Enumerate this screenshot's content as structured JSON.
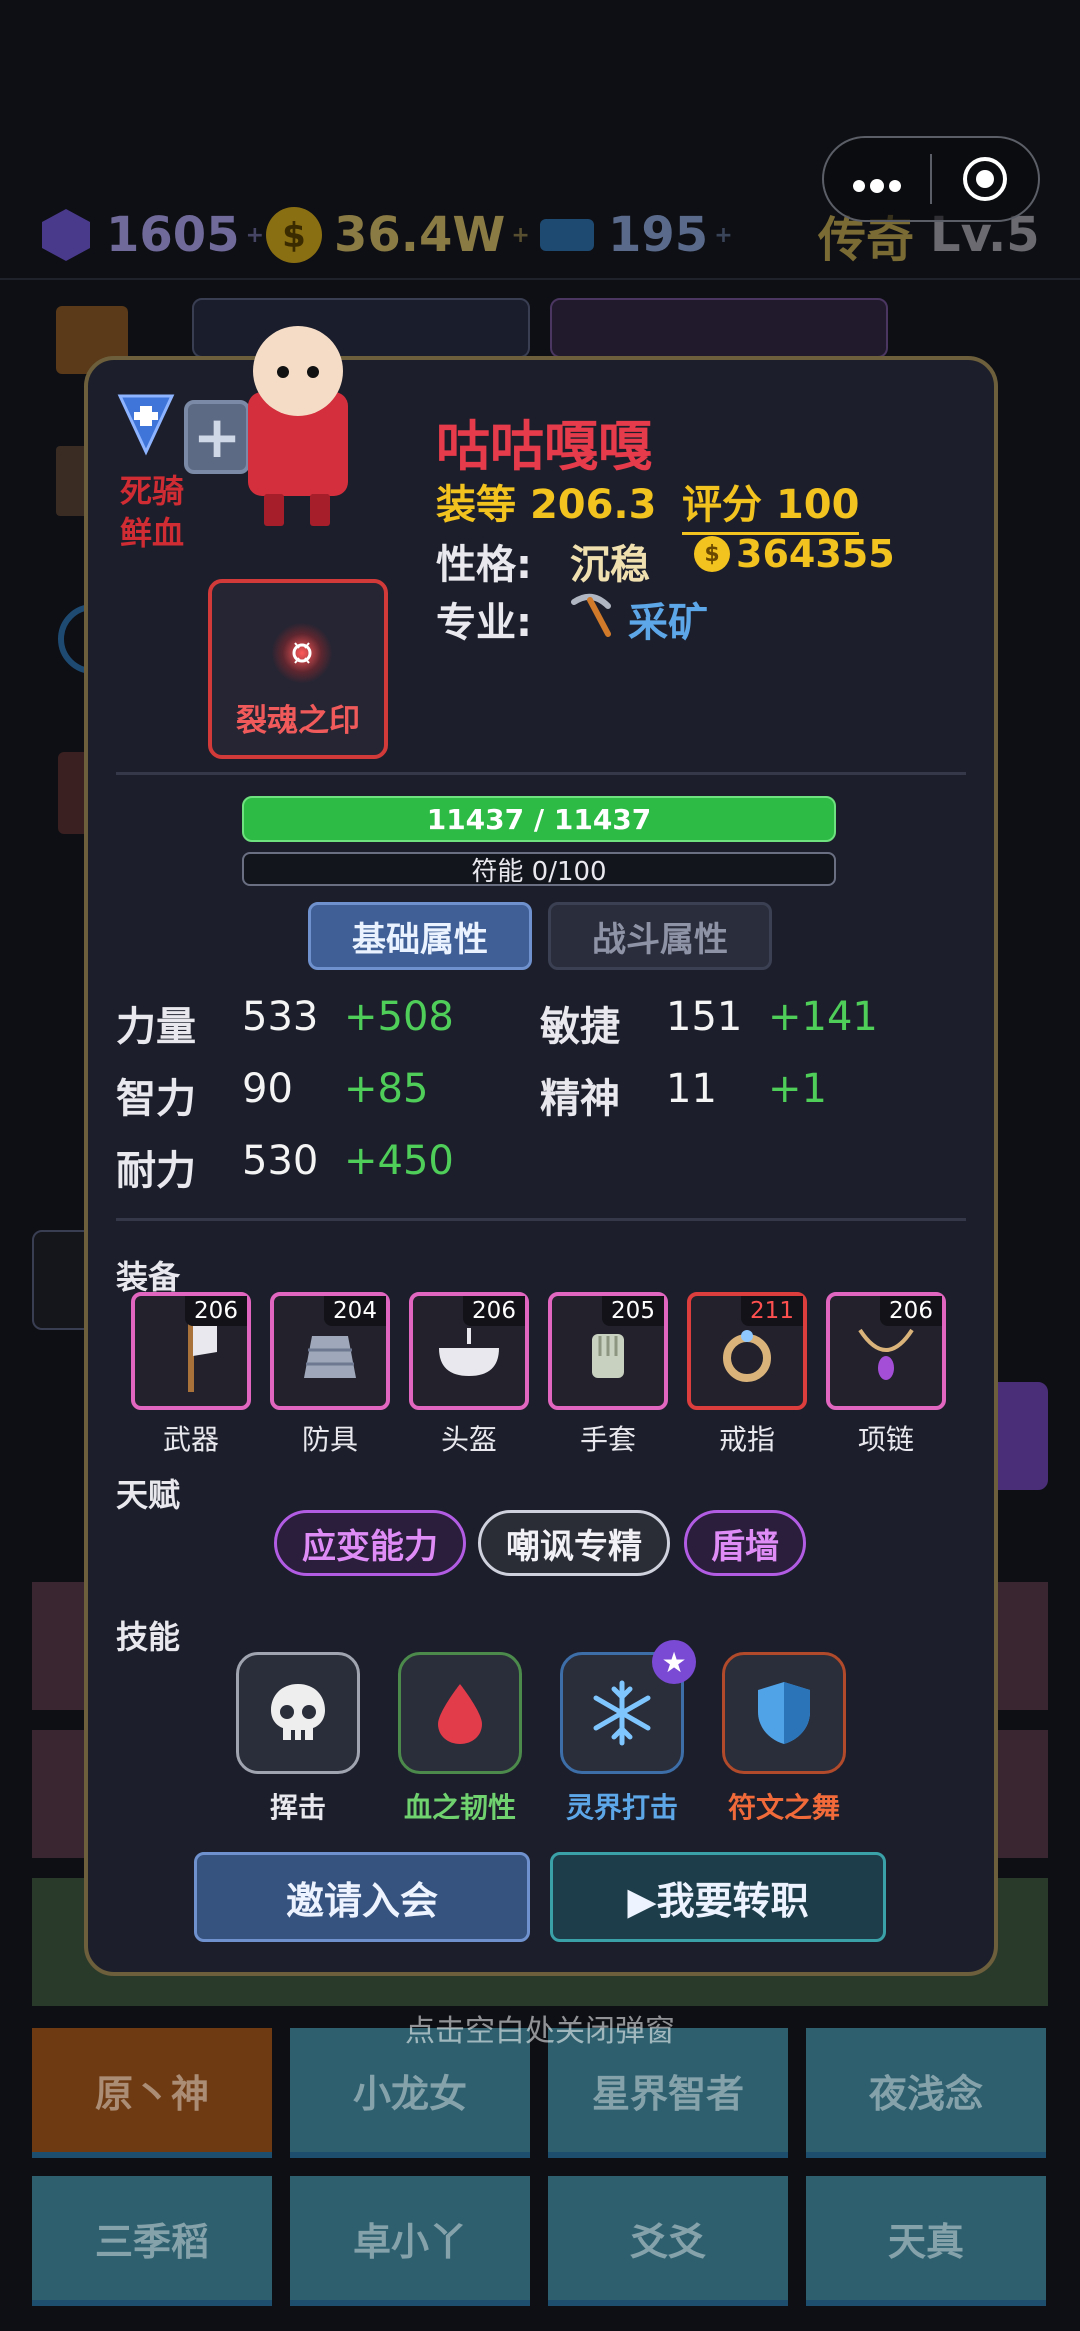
{
  "top_bar": {
    "gems": "1605",
    "coins": "36.4W",
    "tickets": "195",
    "rank": "传奇",
    "level": "Lv.5",
    "plus": "+"
  },
  "background": {
    "grid_names": [
      "原丶神",
      "小龙女",
      "星界智者",
      "夜浅念",
      "三季稻",
      "卓小丫",
      "爻爻",
      "天真"
    ]
  },
  "profile": {
    "tag_text": "死骑\n鲜血",
    "seal_label": "裂魂之印",
    "name": "咕咕嘎嘎",
    "gear_score_label": "装等",
    "gear_score": "206.3",
    "rating_label": "评分",
    "rating": "100",
    "personality_label": "性格:",
    "personality": "沉稳",
    "gold": "364355",
    "profession_label": "专业:",
    "profession": "采矿"
  },
  "bars": {
    "hp_text": "11437 / 11437",
    "rune_text": "符能 0/100"
  },
  "tabs": {
    "basic": "基础属性",
    "combat": "战斗属性"
  },
  "stats": [
    {
      "name": "力量",
      "base": "533",
      "bonus": "+508"
    },
    {
      "name": "敏捷",
      "base": "151",
      "bonus": "+141"
    },
    {
      "name": "智力",
      "base": "90",
      "bonus": "+85"
    },
    {
      "name": "精神",
      "base": "11",
      "bonus": "+1"
    },
    {
      "name": "耐力",
      "base": "530",
      "bonus": "+450"
    }
  ],
  "equipment": {
    "title": "装备",
    "items": [
      {
        "label": "武器",
        "level": "206"
      },
      {
        "label": "防具",
        "level": "204"
      },
      {
        "label": "头盔",
        "level": "206"
      },
      {
        "label": "手套",
        "level": "205"
      },
      {
        "label": "戒指",
        "level": "211"
      },
      {
        "label": "项链",
        "level": "206"
      }
    ]
  },
  "talents": {
    "title": "天赋",
    "items": [
      "应变能力",
      "嘲讽专精",
      "盾墙"
    ]
  },
  "skills": {
    "title": "技能",
    "items": [
      {
        "label": "挥击",
        "color": "#e8e8ee"
      },
      {
        "label": "血之韧性",
        "color": "#6fd26f"
      },
      {
        "label": "灵界打击",
        "color": "#5da6e8"
      },
      {
        "label": "符文之舞",
        "color": "#f06a3a"
      }
    ]
  },
  "buttons": {
    "invite": "邀请入会",
    "change_job": "▶我要转职"
  },
  "hint": "点击空白处关闭弹窗"
}
